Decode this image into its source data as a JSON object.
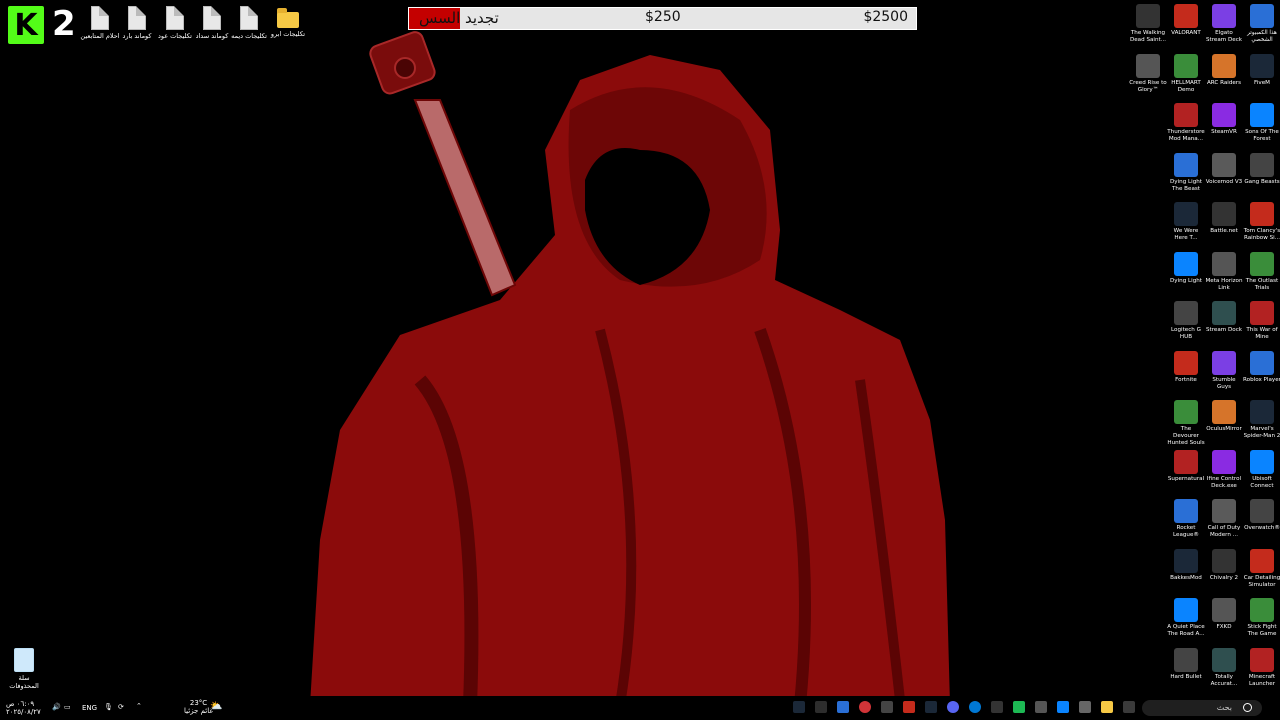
{
  "desktop": {
    "kick_count": "2",
    "top_icons": [
      {
        "label": "تكليجات ابرو",
        "kind": "folder"
      },
      {
        "label": "تكليجات ديمه",
        "kind": "file"
      },
      {
        "label": "كوماند سداد",
        "kind": "file"
      },
      {
        "label": "تكليجات عود",
        "kind": "file"
      },
      {
        "label": "كوماند بارد",
        "kind": "file"
      },
      {
        "label": "احلام المتابعين",
        "kind": "file"
      }
    ],
    "recycle_bin": "سلة المحذوفات"
  },
  "donation": {
    "title": "تجديد السس",
    "current": "$250",
    "goal": "$2500",
    "progress": 0.1,
    "fill_color": "#c40000"
  },
  "right_icons": [
    [
      "هذا الكمبيوتر الشخصي",
      "Elgato Stream Deck",
      "VALORANT",
      "The Walking Dead Saint..."
    ],
    [
      "FiveM",
      "ARC Raiders",
      "HELLMART Demo",
      "Creed Rise to Glory™"
    ],
    [
      "Sons Of The Forest",
      "SteamVR",
      "Thunderstore Mod Mana..."
    ],
    [
      "Gang Beasts",
      "Voicemod V3",
      "Dying Light The Beast"
    ],
    [
      "Tom Clancy's Rainbow Si...",
      "Battle.net",
      "We Were Here T..."
    ],
    [
      "The Outlast Trials",
      "Meta Horizon Link",
      "Dying Light"
    ],
    [
      "This War of Mine",
      "Stream Dock",
      "Logitech G HUB"
    ],
    [
      "Roblox Player",
      "Stumble Guys",
      "Fortnite"
    ],
    [
      "Marvel's Spider-Man 2",
      "OculusMirror",
      "The Devourer Hunted Souls"
    ],
    [
      "Ubisoft Connect",
      "Ifine Control Deck.exe",
      "Supernatural"
    ],
    [
      "Overwatch®",
      "Call of Duty Modern ...",
      "Rocket League®"
    ],
    [
      "Car Detailing Simulator",
      "Chivalry 2",
      "BakkesMod"
    ],
    [
      "Stick Fight The Game",
      "FXKD",
      "A Quiet Place The Road A..."
    ],
    [
      "Minecraft Launcher",
      "Totally Accurat...",
      "Hard Bullet"
    ]
  ],
  "taskbar": {
    "weather_temp": "23°C",
    "weather_desc": "غائم جزئيا",
    "lang": "ENG",
    "time": "٠٦:٠٩ ص",
    "date": "٢٠٢٥/٠٨/٢٧",
    "search_placeholder": "بحث"
  }
}
